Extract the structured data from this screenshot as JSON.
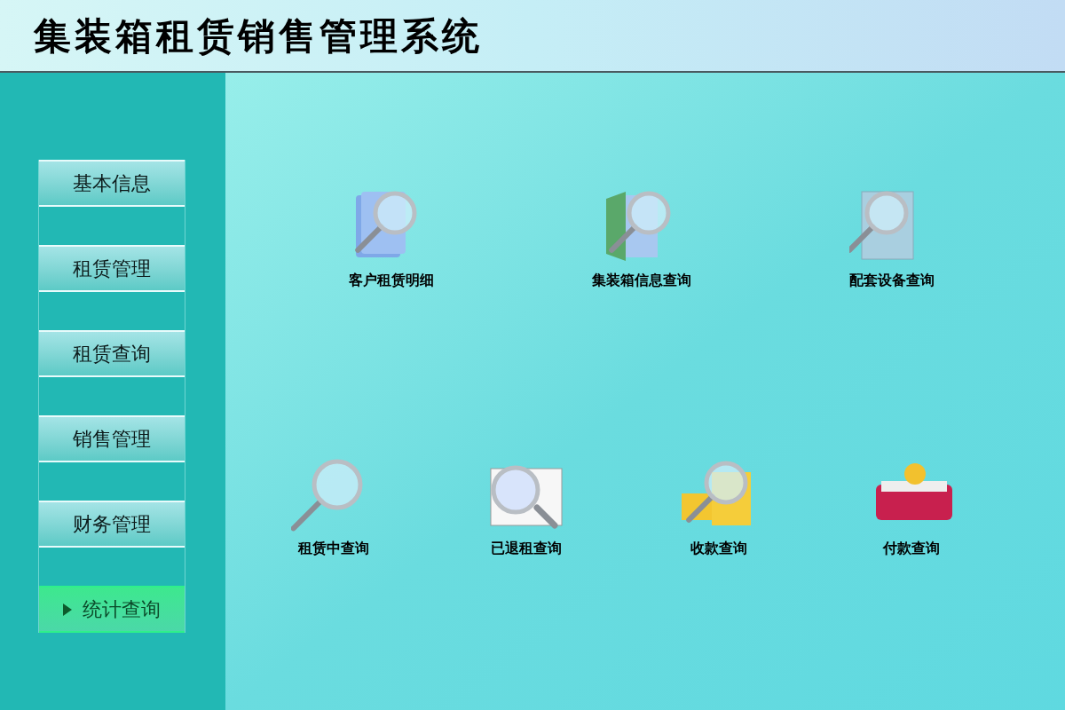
{
  "header": {
    "title": "集装箱租赁销售管理系统"
  },
  "sidebar": {
    "items": [
      {
        "label": "基本信息",
        "selected": false
      },
      {
        "label": "租赁管理",
        "selected": false
      },
      {
        "label": "租赁查询",
        "selected": false
      },
      {
        "label": "销售管理",
        "selected": false
      },
      {
        "label": "财务管理",
        "selected": false
      },
      {
        "label": "统计查询",
        "selected": true
      }
    ]
  },
  "shortcut_rows": [
    {
      "items": [
        {
          "label": "客户租赁明细",
          "kind": "docs"
        },
        {
          "label": "集装箱信息查询",
          "kind": "folder"
        },
        {
          "label": "配套设备查询",
          "kind": "paper"
        }
      ]
    },
    {
      "items": [
        {
          "label": "租赁中查询",
          "kind": "magnifier"
        },
        {
          "label": "已退租查询",
          "kind": "window"
        },
        {
          "label": "收款查询",
          "kind": "coins"
        },
        {
          "label": "付款查询",
          "kind": "book"
        }
      ]
    }
  ]
}
